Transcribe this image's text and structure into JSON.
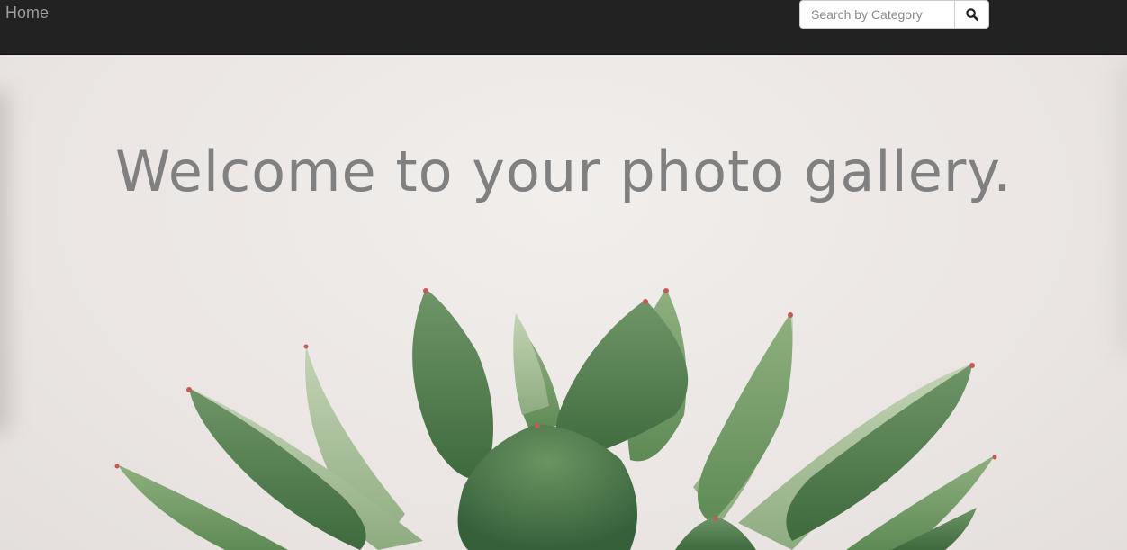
{
  "navbar": {
    "home_label": "Home",
    "search": {
      "placeholder": "Search by Category",
      "value": "",
      "button_icon": "search-icon"
    }
  },
  "hero": {
    "title": "Welcome to your photo gallery.",
    "background_image": "succulent-plant-photo"
  },
  "colors": {
    "navbar_bg": "#222222",
    "nav_link": "#9d9d9d",
    "title": "#808080",
    "hero_bg": "#ede9e7",
    "leaf_dark": "#4f7a4c",
    "leaf_light": "#a9c29a",
    "leaf_tip": "#c45a55"
  }
}
